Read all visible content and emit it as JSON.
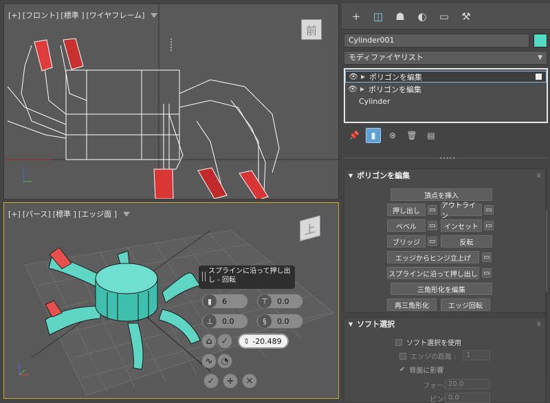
{
  "viewport_front": {
    "label_parts": [
      "[+]",
      "[フロント]",
      "[標準 ]",
      "[ワイヤフレーム]"
    ],
    "viewcube_label": "前"
  },
  "viewport_persp": {
    "label_parts": [
      "[+]",
      "[パース]",
      "[標準 ]",
      "[エッジ面 ]"
    ],
    "viewcube_label": "上"
  },
  "caddy": {
    "title": "スプラインに沿って押し出し - 回転",
    "fields": [
      {
        "icon": "segments-icon",
        "value": "6"
      },
      {
        "icon": "taper-amount-icon",
        "value": "0.0"
      },
      {
        "icon": "taper-curve-icon",
        "value": "0.0"
      },
      {
        "icon": "twist-icon",
        "value": "0.0"
      }
    ],
    "active_value": "-20.489"
  },
  "command_panel": {
    "tabs": [
      {
        "name": "create-tab",
        "glyph": "+"
      },
      {
        "name": "modify-tab",
        "glyph": "◫"
      },
      {
        "name": "hierarchy-tab",
        "glyph": "☗"
      },
      {
        "name": "motion-tab",
        "glyph": "◐"
      },
      {
        "name": "display-tab",
        "glyph": "▭"
      },
      {
        "name": "utilities-tab",
        "glyph": "🔧"
      }
    ],
    "object_name": "Cylinder001",
    "object_color": "#55d9c2",
    "modifier_list_label": "モディファイヤリスト",
    "stack": [
      {
        "label": "ポリゴンを編集",
        "selected": true
      },
      {
        "label": "ポリゴンを編集",
        "selected": false
      },
      {
        "label": "Cylinder",
        "selected": false
      }
    ]
  },
  "edit_poly": {
    "title": "ポリゴンを編集",
    "insert_vertex": "頂点を挿入",
    "extrude": "押し出し",
    "outline": "アウトライン",
    "bevel": "ベベル",
    "inset": "インセット",
    "bridge": "ブリッジ",
    "flip": "反転",
    "hinge": "エッジからヒンジ立上げ",
    "extrude_spline": "スプラインに沿って押し出し",
    "edit_tri": "三角形化を編集",
    "retriangulate": "再三角形化",
    "turn_edge": "エッジ回転"
  },
  "soft_selection": {
    "title": "ソフト選択",
    "use_soft": "ソフト選択を使用",
    "edge_distance": "エッジの距離 :",
    "edge_distance_value": "1",
    "affect_backfacing": "背面に影響",
    "falloff": "フォールオフ :",
    "falloff_value": "20.0",
    "pinch": "ピンチ :",
    "pinch_value": "0.0"
  }
}
